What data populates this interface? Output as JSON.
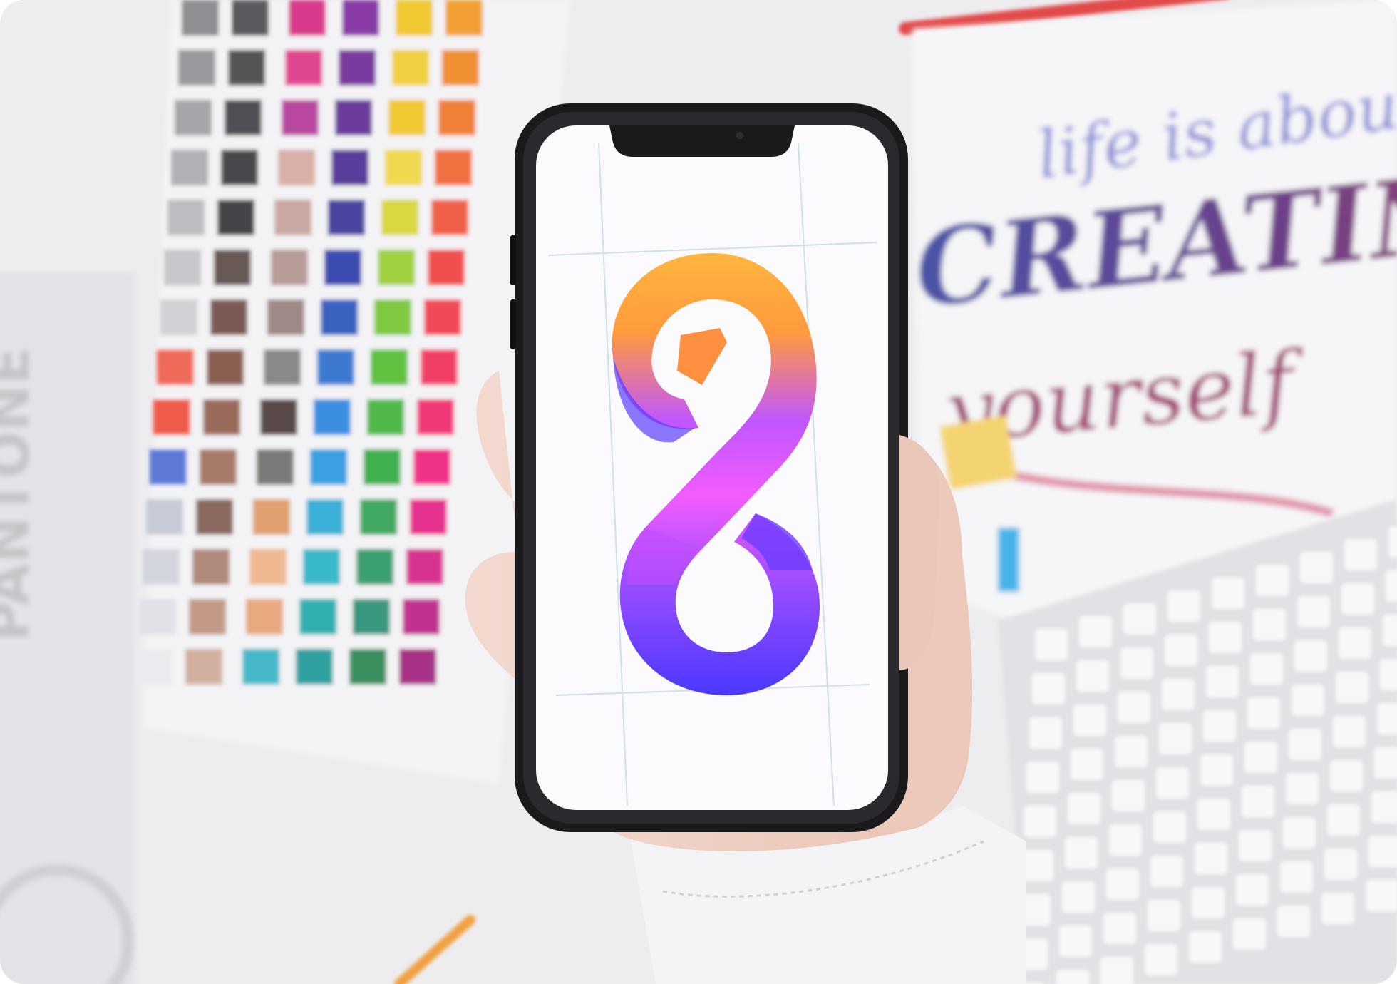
{
  "photo": {
    "subject": "hand-holding-smartphone-with-gradient-logo",
    "lettering_top": "life is about",
    "lettering_main": "CREATING",
    "lettering_bottom": "yourself",
    "book_spine": "PANTONE",
    "logo": "infinity-eight",
    "colors": {
      "background": "#eeeef1",
      "logo_top": "#ffb640",
      "logo_mid": "#e85cff",
      "logo_bottom": "#4a38ff"
    }
  }
}
